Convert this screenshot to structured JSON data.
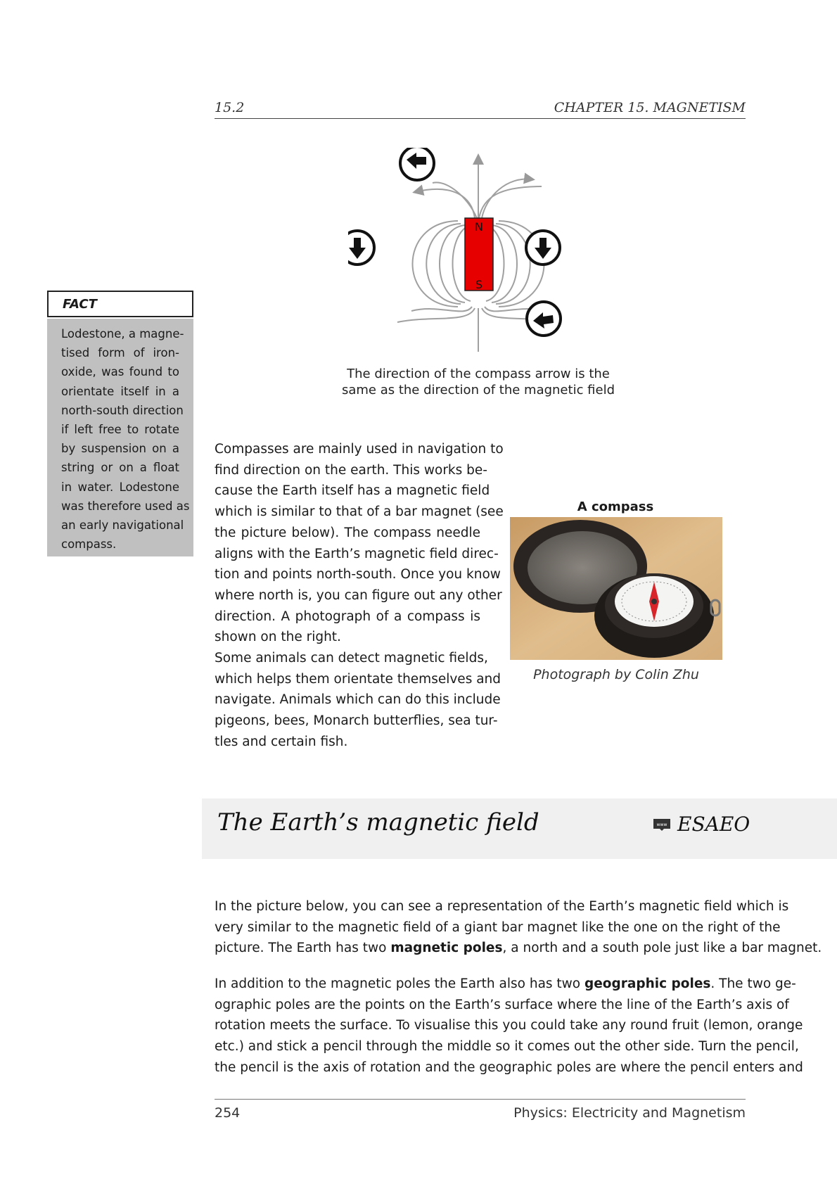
{
  "header": {
    "section": "15.2",
    "chapter": "CHAPTER 15.  MAGNETISM"
  },
  "figure": {
    "magnet_north_label": "N",
    "magnet_south_label": "S",
    "caption_line1": "The direction of the compass arrow is the",
    "caption_line2": "same as the direction of the magnetic field",
    "colors": {
      "magnet": "#e00000",
      "field_lines": "#999999"
    }
  },
  "fact": {
    "title": "FACT",
    "lines": [
      "Lodestone, a magne-",
      "tised form of iron-",
      "oxide, was found to",
      "orientate itself in a",
      "north-south direction",
      "if left free to rotate",
      "by suspension on a",
      "string or on a float",
      "in water. Lodestone",
      "was therefore used as",
      "an early navigational",
      "compass."
    ]
  },
  "column": {
    "lines": [
      "Compasses are mainly used in navigation to",
      "find direction on the earth. This works be-",
      "cause the Earth itself has a magnetic field",
      "which is similar to that of a bar magnet (see",
      "the picture below). The compass needle",
      "aligns with the Earth’s magnetic field direc-",
      "tion and points north-south. Once you know",
      "where north is, you can figure out any other",
      "direction. A photograph of a compass is",
      "shown on the right.",
      "Some animals can detect magnetic fields,",
      "which helps them orientate themselves and",
      "navigate. Animals which can do this include",
      "pigeons, bees, Monarch butterflies, sea tur-",
      "tles and certain fish."
    ]
  },
  "photo": {
    "title": "A compass",
    "credit": "Photograph by Colin Zhu"
  },
  "section": {
    "title": "The Earth’s magnetic field",
    "code": "ESAEO",
    "icon": "www-icon"
  },
  "paragraph1": {
    "l1": "In the picture below, you can see a representation of the Earth’s magnetic field which is",
    "l2": "very similar to the magnetic field of a giant bar magnet like the one on the right of the",
    "l3a": "picture. The Earth has two ",
    "l3b": "magnetic poles",
    "l3c": ", a north and a south pole just like a bar magnet."
  },
  "paragraph2": {
    "l1a": "In addition to the magnetic poles the Earth also has two ",
    "l1b": "geographic poles",
    "l1c": ". The two ge-",
    "l2": "ographic poles are the points on the Earth’s surface where the line of the Earth’s axis of",
    "l3": "rotation meets the surface. To visualise this you could take any round fruit (lemon, orange",
    "l4": "etc.) and stick a pencil through the middle so it comes out the other side. Turn the pencil,",
    "l5": "the pencil is the axis of rotation and the geographic poles are where the pencil enters and"
  },
  "footer": {
    "page": "254",
    "book": "Physics: Electricity and Magnetism"
  }
}
